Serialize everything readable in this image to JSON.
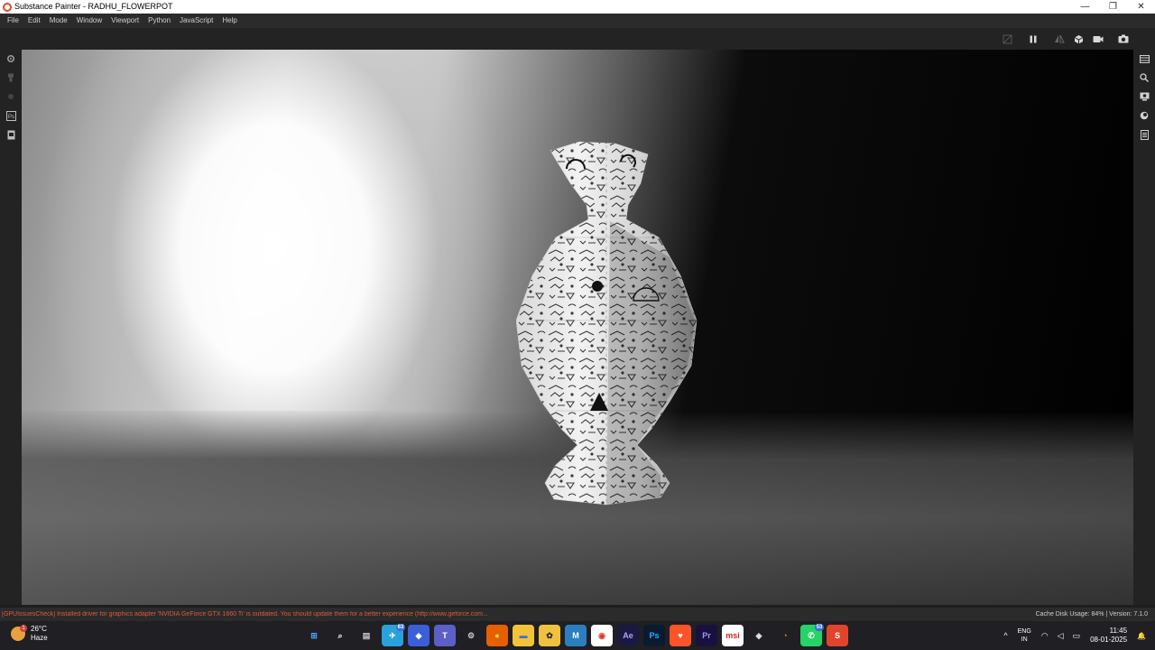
{
  "window": {
    "title": "Substance Painter - RADHU_FLOWERPOT",
    "controls": {
      "minimize": "—",
      "maximize": "❐",
      "close": "✕"
    }
  },
  "menu": {
    "items": [
      "File",
      "Edit",
      "Mode",
      "Window",
      "Viewport",
      "Python",
      "JavaScript",
      "Help"
    ]
  },
  "toolbar": {
    "right_icons": [
      "solo-icon",
      "pause-icon",
      "symmetry-icon",
      "view-mode-icon",
      "camera-icon",
      "screenshot-icon"
    ]
  },
  "left_strip": {
    "icons": [
      "settings-icon",
      "paint-icon",
      "brush-icon",
      "photoshop-icon",
      "export-icon"
    ]
  },
  "right_strip": {
    "icons": [
      "layers-icon",
      "zoom-icon",
      "display-icon",
      "environment-icon",
      "notes-icon"
    ]
  },
  "status_bar": {
    "message": "[GPUIssuesCheck] Installed driver for graphics adapter 'NVIDIA GeForce GTX 1660 Ti' is outdated. You should update them for a better experience (http://www.geforce.com...",
    "cache": "Cache Disk Usage:   84% | Version: 7.1.0",
    "message_color": "#e05a3a"
  },
  "taskbar": {
    "weather": {
      "temp": "26°C",
      "condition": "Haze",
      "badge": "1"
    },
    "apps": [
      {
        "name": "windows-start",
        "label": "⊞",
        "bg": "#1f1f24",
        "color": "#4aa3ff"
      },
      {
        "name": "search",
        "label": "⌕",
        "bg": "#1f1f24",
        "color": "#ffffff"
      },
      {
        "name": "task-view",
        "label": "▤",
        "bg": "#1f1f24",
        "color": "#c8c8c8"
      },
      {
        "name": "telegram",
        "label": "✈",
        "bg": "#2aa1da",
        "color": "#ffffff",
        "badge": "63"
      },
      {
        "name": "copilot",
        "label": "◆",
        "bg": "#3a5fd8",
        "color": "#ffffff"
      },
      {
        "name": "teams",
        "label": "T",
        "bg": "#5b5fc7",
        "color": "#ffffff"
      },
      {
        "name": "settings",
        "label": "⚙",
        "bg": "#1f1f24",
        "color": "#c8c8c8"
      },
      {
        "name": "firefox",
        "label": "●",
        "bg": "#e66000",
        "color": "#ffd54a"
      },
      {
        "name": "file-explorer",
        "label": "▬",
        "bg": "#f2c23a",
        "color": "#3a6fd8"
      },
      {
        "name": "sketch",
        "label": "✿",
        "bg": "#f0c040",
        "color": "#2a2a2a"
      },
      {
        "name": "maps",
        "label": "M",
        "bg": "#2b7fbf",
        "color": "#ffffff"
      },
      {
        "name": "chrome",
        "label": "◉",
        "bg": "#ffffff",
        "color": "#d93b30"
      },
      {
        "name": "after-effects",
        "label": "Ae",
        "bg": "#1a1a40",
        "color": "#b1a1ff"
      },
      {
        "name": "photoshop",
        "label": "Ps",
        "bg": "#0a1b30",
        "color": "#31a8ff"
      },
      {
        "name": "brave",
        "label": "♥",
        "bg": "#fb542b",
        "color": "#ffffff"
      },
      {
        "name": "premiere",
        "label": "Pr",
        "bg": "#1a1040",
        "color": "#9999ff"
      },
      {
        "name": "msi",
        "label": "msi",
        "bg": "#ffffff",
        "color": "#d02020"
      },
      {
        "name": "unity",
        "label": "◈",
        "bg": "#1f1f24",
        "color": "#e8e8e8"
      },
      {
        "name": "blender",
        "label": "◔",
        "bg": "#1f1f24",
        "color": "#f08020"
      },
      {
        "name": "whatsapp",
        "label": "✆",
        "bg": "#25d366",
        "color": "#ffffff",
        "badge": "53"
      },
      {
        "name": "substance-painter",
        "label": "S",
        "bg": "#e0452c",
        "color": "#ffffff"
      }
    ],
    "tray": {
      "chevron": "^",
      "lang_top": "ENG",
      "lang_bottom": "IN",
      "wifi": "◠",
      "volume": "◁",
      "battery": "▭",
      "time": "11:45",
      "date": "08-01-2025",
      "bell": "🔔"
    }
  }
}
